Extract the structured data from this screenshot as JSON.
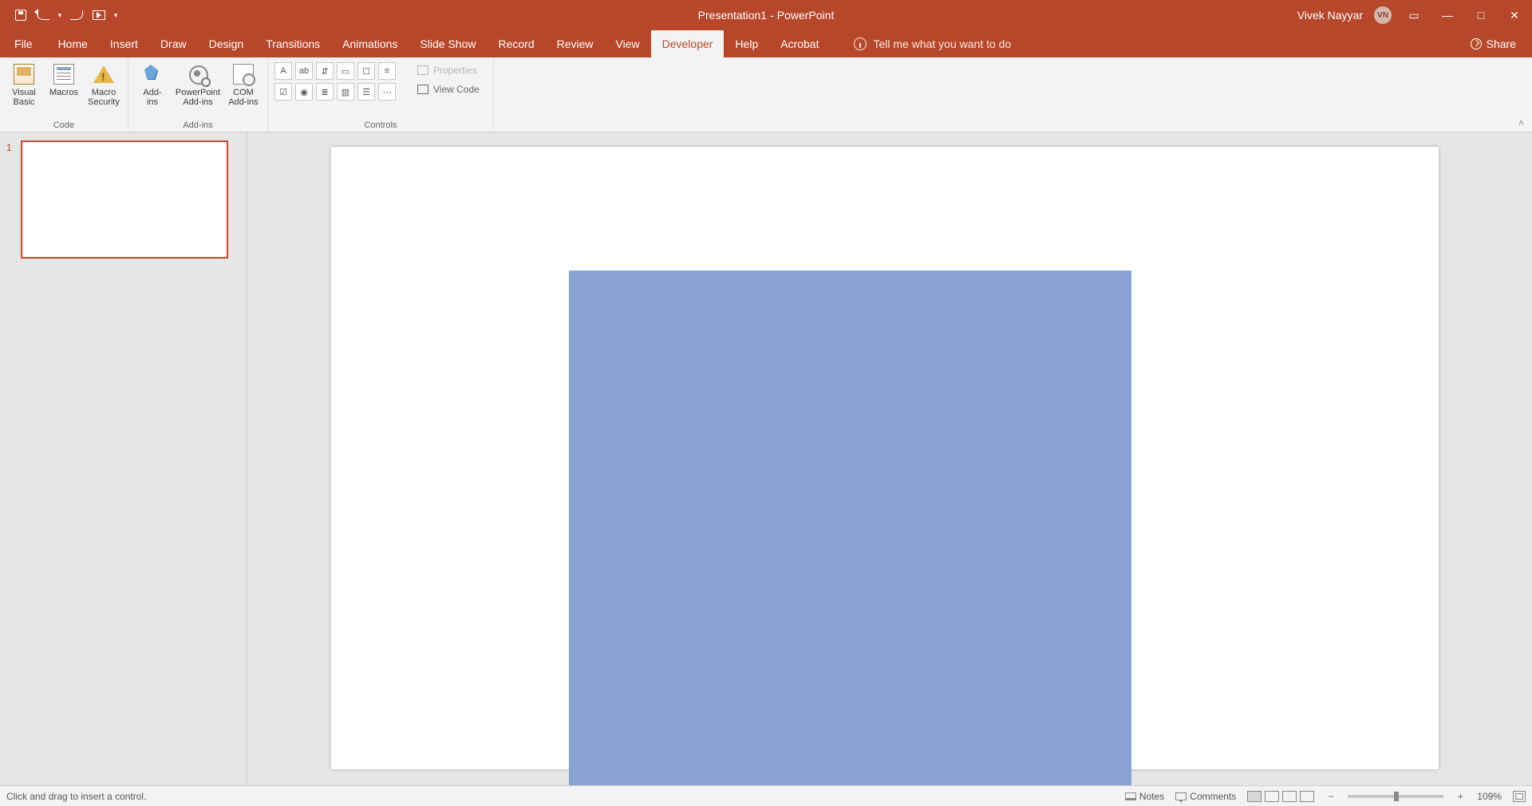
{
  "title": {
    "doc": "Presentation1",
    "sep": "  -  ",
    "app": "PowerPoint"
  },
  "user": {
    "name": "Vivek Nayyar",
    "initials": "VN"
  },
  "tabs": {
    "file": "File",
    "home": "Home",
    "insert": "Insert",
    "draw": "Draw",
    "design": "Design",
    "transitions": "Transitions",
    "animations": "Animations",
    "slideshow": "Slide Show",
    "record": "Record",
    "review": "Review",
    "view": "View",
    "developer": "Developer",
    "help": "Help",
    "acrobat": "Acrobat"
  },
  "tellme": "Tell me what you want to do",
  "share": "Share",
  "ribbon": {
    "code": {
      "label": "Code",
      "visual_basic": "Visual\nBasic",
      "macros": "Macros",
      "macro_security": "Macro\nSecurity"
    },
    "addins": {
      "label": "Add-ins",
      "addins": "Add-\nins",
      "pp_addins": "PowerPoint\nAdd-ins",
      "com_addins": "COM\nAdd-ins"
    },
    "controls": {
      "label": "Controls",
      "properties": "Properties",
      "view_code": "View Code"
    }
  },
  "thumbs": {
    "n1": "1"
  },
  "status": {
    "left": "Click and drag to insert a control.",
    "notes": "Notes",
    "comments": "Comments",
    "zoom": "109%"
  }
}
